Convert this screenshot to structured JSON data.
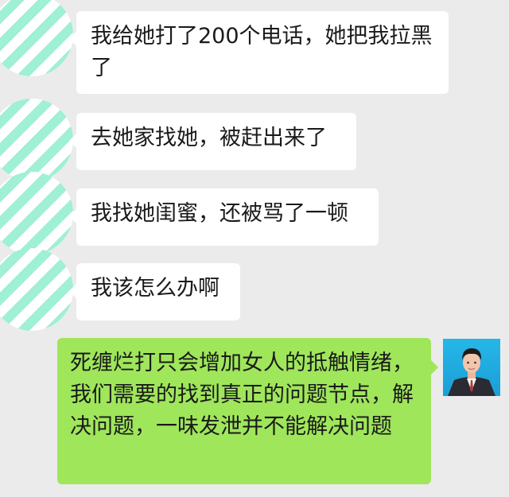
{
  "messages": [
    {
      "side": "left",
      "text": "我给她打了200个电话，她把我拉黑了"
    },
    {
      "side": "left",
      "text": "去她家找她，被赶出来了"
    },
    {
      "side": "left",
      "text": "我找她闺蜜，还被骂了一顿"
    },
    {
      "side": "left",
      "text": "我该怎么办啊"
    },
    {
      "side": "right",
      "text": "死缠烂打只会增加女人的抵触情绪，我们需要的找到真正的问题节点，解决问题，一味发泄并不能解决问题"
    }
  ],
  "icons": {
    "left_avatar": "striped-avatar-icon",
    "right_avatar": "profile-photo-avatar"
  },
  "colors": {
    "background": "#ebebeb",
    "incoming_bubble": "#ffffff",
    "outgoing_bubble": "#9fe65b",
    "avatar_stripe": "#9ff0d4"
  }
}
